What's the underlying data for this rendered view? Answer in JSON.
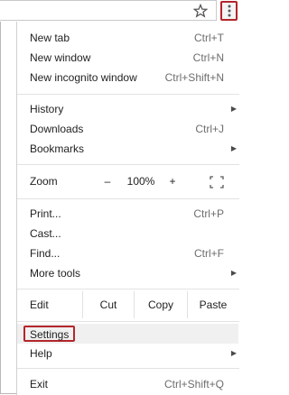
{
  "menu": {
    "items": [
      {
        "label": "New tab",
        "shortcut": "Ctrl+T"
      },
      {
        "label": "New window",
        "shortcut": "Ctrl+N"
      },
      {
        "label": "New incognito window",
        "shortcut": "Ctrl+Shift+N"
      },
      {
        "label": "History",
        "shortcut": ""
      },
      {
        "label": "Downloads",
        "shortcut": "Ctrl+J"
      },
      {
        "label": "Bookmarks",
        "shortcut": ""
      },
      {
        "label": "Print...",
        "shortcut": "Ctrl+P"
      },
      {
        "label": "Cast...",
        "shortcut": ""
      },
      {
        "label": "Find...",
        "shortcut": "Ctrl+F"
      },
      {
        "label": "More tools",
        "shortcut": ""
      },
      {
        "label": "Settings",
        "shortcut": ""
      },
      {
        "label": "Help",
        "shortcut": ""
      },
      {
        "label": "Exit",
        "shortcut": "Ctrl+Shift+Q"
      }
    ],
    "zoom": {
      "label": "Zoom",
      "minus": "–",
      "value": "100%",
      "plus": "+",
      "fullscreen_icon": "fullscreen-icon"
    },
    "edit": {
      "label": "Edit",
      "cut": "Cut",
      "copy": "Copy",
      "paste": "Paste"
    },
    "submenu_arrow": "▶"
  },
  "toolbar": {
    "star_icon": "star-icon",
    "menu_icon": "more-vertical-icon"
  },
  "colors": {
    "highlight_outline": "#b3262b",
    "hover_background": "#f0f0f0"
  }
}
